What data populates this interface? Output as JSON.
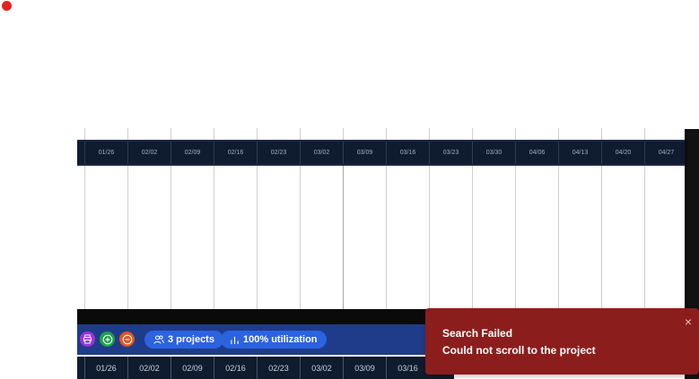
{
  "timeline": {
    "header_weeks": [
      "01/26",
      "02/02",
      "02/09",
      "02/16",
      "02/23",
      "03/02",
      "03/09",
      "03/16",
      "03/23",
      "03/30",
      "04/06",
      "04/13",
      "04/20",
      "04/27"
    ],
    "footer_weeks": [
      "01/26",
      "02/02",
      "02/09",
      "02/16",
      "02/23",
      "03/02",
      "03/09",
      "03/16"
    ]
  },
  "toolbar": {
    "print_icon": "printer-icon",
    "add_icon": "plus-icon",
    "remove_icon": "minus-icon",
    "projects_label": "3 projects",
    "utilization_label": "100% utilization",
    "colors": {
      "print": "#9b34d6",
      "add": "#1aa34a",
      "remove": "#e2551f",
      "pill": "#2b63e0",
      "bar": "#1f3c8a"
    }
  },
  "toast": {
    "title": "Search Failed",
    "message": "Could not scroll to the project",
    "close": "×",
    "color": "#8b1e1d"
  }
}
